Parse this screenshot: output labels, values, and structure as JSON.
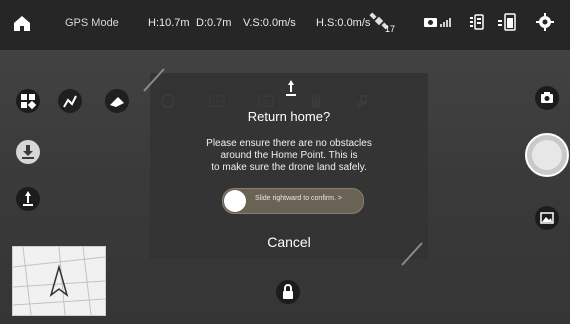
{
  "topbar": {
    "mode": "GPS Mode",
    "height": "H:10.7m",
    "distance": "D:0.7m",
    "vertical_speed": "V.S:0.0m/s",
    "horizontal_speed": "H.S:0.0m/s",
    "satellites": "17"
  },
  "modal": {
    "title": "Return home?",
    "message_line1": "Please ensure there are no obstacles",
    "message_line2": "around the Home Point. This is",
    "message_line3": "to make sure the drone land safely.",
    "slider_text": "Slide rightward to confirm. >",
    "cancel_label": "Cancel"
  },
  "colors": {
    "topbar": "#262626",
    "modal": "#343434",
    "slider": "#6b6256"
  }
}
